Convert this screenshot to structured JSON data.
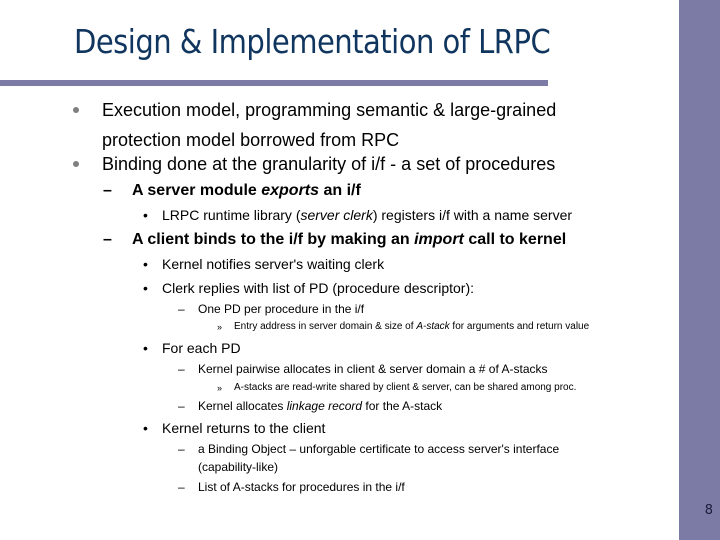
{
  "slide": {
    "title": "Design & Implementation of LRPC",
    "page_number": "8",
    "colors": {
      "accent": "#7b7ba5",
      "title": "#10355e"
    }
  },
  "bullets": {
    "b1_line1": "Execution model, programming semantic & large-grained",
    "b1_line2": "protection model borrowed from RPC",
    "b2": "Binding done at the granularity of i/f - a set of procedures",
    "b2_1_pre": "A server module ",
    "b2_1_em": "exports",
    "b2_1_post": " an i/f",
    "b2_1_1_pre": "LRPC runtime library (",
    "b2_1_1_em": "server clerk",
    "b2_1_1_post": ") registers i/f with a name server",
    "b2_2_pre": "A client binds to the i/f by making an ",
    "b2_2_em": "import",
    "b2_2_post": " call to kernel",
    "b2_2_1": "Kernel notifies server's waiting clerk",
    "b2_2_2": "Clerk replies with list of PD (procedure descriptor):",
    "b2_2_2_1": "One PD per procedure in the i/f",
    "b2_2_2_1_1_pre": "Entry address in server domain & size of ",
    "b2_2_2_1_1_em": "A-stack",
    "b2_2_2_1_1_post": " for arguments and return value",
    "b2_2_3": "For each PD",
    "b2_2_3_1": "Kernel pairwise allocates in client & server domain a # of A-stacks",
    "b2_2_3_1_1": "A-stacks are read-write shared by client & server, can be shared among proc.",
    "b2_2_3_2_pre": "Kernel allocates ",
    "b2_2_3_2_em": "linkage record",
    "b2_2_3_2_post": " for the A-stack",
    "b2_2_4": "Kernel returns to the client",
    "b2_2_4_1_line1": "a Binding Object – unforgable certificate to access server's interface",
    "b2_2_4_1_line2": "(capability-like)",
    "b2_2_4_2": "List of A-stacks for procedures in the i/f"
  },
  "markers": {
    "dash": "–",
    "dot": "•",
    "raquo": "»"
  }
}
